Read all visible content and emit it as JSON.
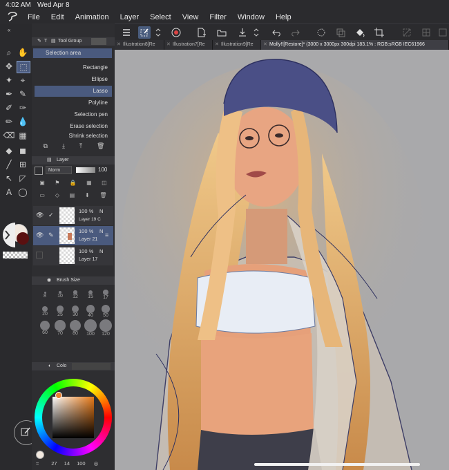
{
  "status": {
    "time": "4:02 AM",
    "date": "Wed Apr 8"
  },
  "menu": [
    "File",
    "Edit",
    "Animation",
    "Layer",
    "Select",
    "View",
    "Filter",
    "Window",
    "Help"
  ],
  "tabs": [
    {
      "label": "Illustration8[Re"
    },
    {
      "label": "Illustration7[Re"
    },
    {
      "label": "Illustration9[Re"
    },
    {
      "label": "Molly!![Restore]* (3000 x 3000px 300dpi 183.1% : RGB:sRGB IEC61966"
    }
  ],
  "tool_group": {
    "title": "Tool Group",
    "tab_letter": "T",
    "current": "Selection area",
    "items": [
      "Rectangle",
      "Ellipse",
      "Lasso",
      "Polyline",
      "Selection pen",
      "Erase selection",
      "Shrink selection"
    ]
  },
  "layer_panel": {
    "title": "Layer",
    "blend_mode": "Norm",
    "opacity": "100",
    "layers": [
      {
        "opacity": "100 %",
        "mode": "N",
        "name": "Layer 19 C"
      },
      {
        "opacity": "100 %",
        "mode": "N",
        "name": "Layer 21"
      },
      {
        "opacity": "100 %",
        "mode": "N",
        "name": "Layer 17"
      }
    ]
  },
  "brush_size": {
    "title": "Brush Size",
    "sizes": [
      "8",
      "10",
      "12",
      "15",
      "17",
      "20",
      "25",
      "30",
      "40",
      "50",
      "60",
      "70",
      "80",
      "100",
      "120"
    ]
  },
  "color_panel": {
    "title": "Colo",
    "footer": [
      "27",
      "14",
      "100"
    ]
  },
  "colors": {
    "accent": "#4a5a7e",
    "main_color": "#b45a1e"
  }
}
